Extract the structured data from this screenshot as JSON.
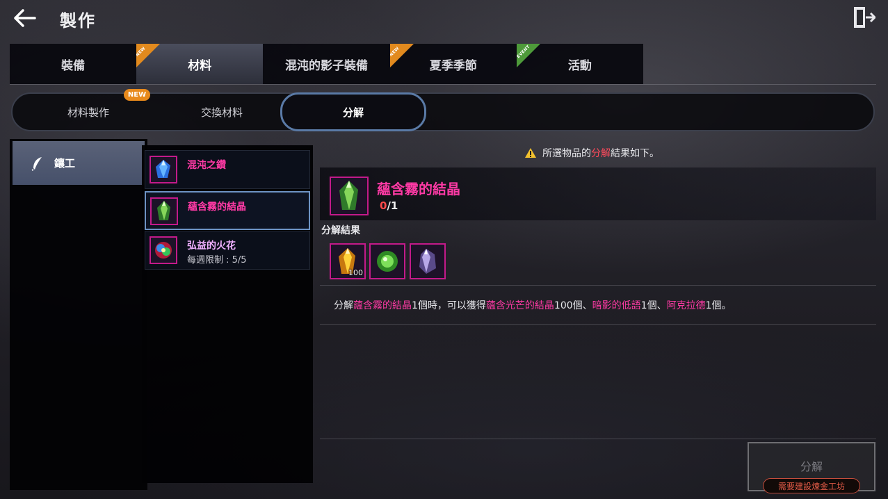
{
  "header": {
    "title": "製作",
    "back_icon": "arrow-left-icon",
    "exit_icon": "exit-door-icon"
  },
  "main_tabs": [
    {
      "label": "裝備",
      "badge": "",
      "active": false
    },
    {
      "label": "材料",
      "badge": "NEW",
      "active": true
    },
    {
      "label": "混沌的影子裝備",
      "badge": "",
      "active": false
    },
    {
      "label": "夏季季節",
      "badge": "NEW",
      "active": false
    },
    {
      "label": "活動",
      "badge": "EVENT",
      "active": false
    }
  ],
  "sub_tabs": [
    {
      "label": "材料製作",
      "active": false
    },
    {
      "label": "交換材料",
      "active": false
    },
    {
      "label": "分解",
      "active": true
    }
  ],
  "sub_tab_badge": "NEW",
  "category": {
    "label": "鑲工",
    "icon": "feather-icon"
  },
  "items": [
    {
      "name": "混沌之鑽",
      "sub": "",
      "icon": "blue-gem-icon"
    },
    {
      "name": "蘊含霧的結晶",
      "sub": "",
      "icon": "green-crystal-icon",
      "selected": true
    },
    {
      "name": "弘益的火花",
      "sub": "每週限制 : 5/5",
      "icon": "rainbow-orb-icon"
    }
  ],
  "notice": {
    "icon": "warning-icon",
    "pre": "所選物品的",
    "highlight": "分解",
    "post": "結果如下。"
  },
  "detail": {
    "name": "蘊含霧的結晶",
    "count_owned": "0",
    "count_sep": "/1",
    "result_label": "分解結果",
    "results": [
      {
        "icon": "gold-crystal-icon",
        "qty": "100"
      },
      {
        "icon": "green-orb-icon",
        "qty": ""
      },
      {
        "icon": "purple-shard-icon",
        "qty": ""
      }
    ]
  },
  "description": {
    "p1": "分解",
    "h1": "蘊含霧的結晶",
    "p2": "1個時，可以獲得",
    "h2": "蘊含光芒的結晶",
    "p3": "100個、",
    "h3": "暗影的低語",
    "p4": "1個、",
    "h4": "阿克拉德",
    "p5": "1個。"
  },
  "action": {
    "button_label": "分解",
    "requirement": "需要建設煉金工坊"
  },
  "colors": {
    "accent_pink": "#ff3aa5",
    "warning_red": "#ff4a5c",
    "active_tab_border": "#5a7aa6",
    "new_orange": "#e88a1c",
    "event_green": "#4e9a3a"
  }
}
